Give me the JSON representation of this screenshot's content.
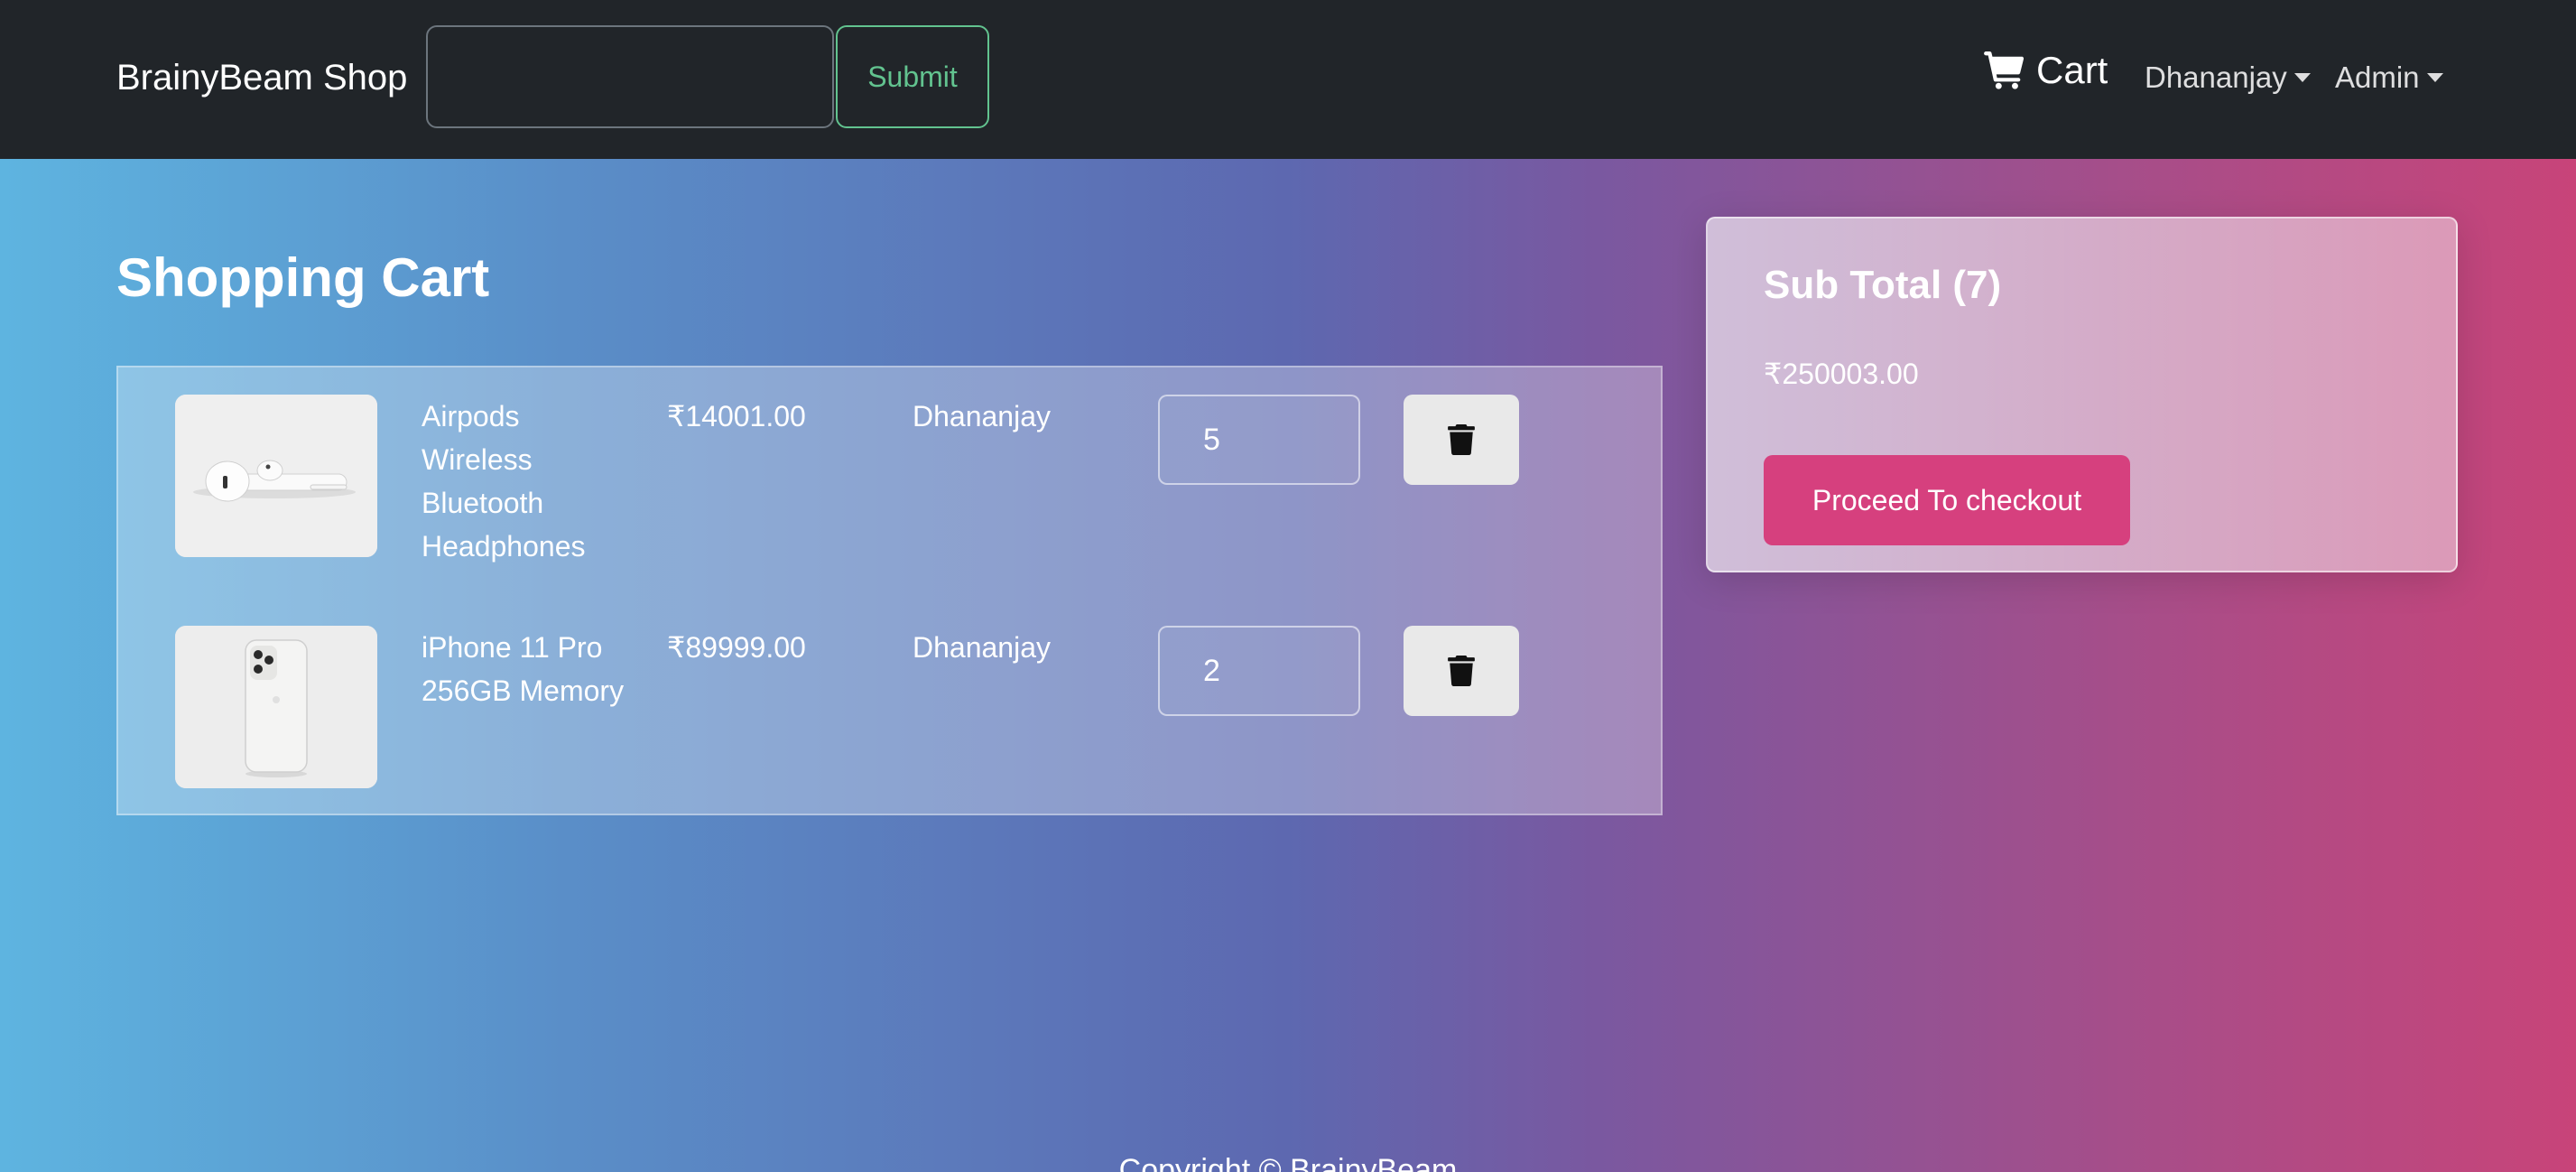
{
  "navbar": {
    "brand": "BrainyBeam Shop",
    "search": {
      "value": "",
      "placeholder": ""
    },
    "submit_label": "Submit",
    "cart_label": "Cart",
    "user_menu_label": "Dhananjay",
    "admin_menu_label": "Admin"
  },
  "page_title": "Shopping Cart",
  "cart": {
    "items": [
      {
        "image": "airpods-product-image",
        "name": "Airpods Wireless Bluetooth Headphones",
        "price": "₹14001.00",
        "seller": "Dhananjay",
        "quantity": "5",
        "delete_icon": "trash-icon"
      },
      {
        "image": "iphone-product-image",
        "name": "iPhone 11 Pro 256GB Memory",
        "price": "₹89999.00",
        "seller": "Dhananjay",
        "quantity": "2",
        "delete_icon": "trash-icon"
      }
    ]
  },
  "summary": {
    "title": "Sub Total (7)",
    "total": "₹250003.00",
    "checkout_label": "Proceed To checkout"
  },
  "footer": {
    "text": "Copyright © BrainyBeam"
  },
  "colors": {
    "navbar_bg": "#212529",
    "submit_accent": "#62c38f",
    "checkout_button": "#d6407e",
    "gradient_left": "#5eb4e0",
    "gradient_mid": "#5d68b0",
    "gradient_right": "#c84479"
  }
}
